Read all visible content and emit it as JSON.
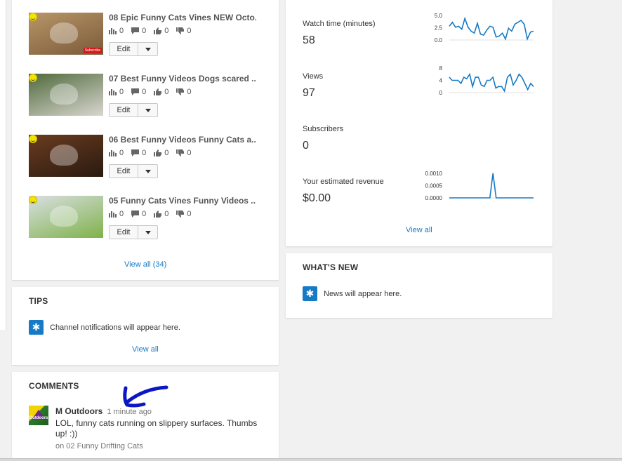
{
  "videos": {
    "items": [
      {
        "title": "08 Epic Funny Cats Vines NEW Octo...",
        "views": "0",
        "comments": "0",
        "likes": "0",
        "dislikes": "0",
        "edit_label": "Edit",
        "thumb_colors": [
          "#b89668",
          "#7a5a3a"
        ],
        "thumb_badge": "Subscribe"
      },
      {
        "title": "07 Best Funny Videos Dogs scared ...",
        "views": "0",
        "comments": "0",
        "likes": "0",
        "dislikes": "0",
        "edit_label": "Edit",
        "thumb_colors": [
          "#4f6a3c",
          "#d9d6cf"
        ]
      },
      {
        "title": "06 Best Funny Videos Funny Cats a...",
        "views": "0",
        "comments": "0",
        "likes": "0",
        "dislikes": "0",
        "edit_label": "Edit",
        "thumb_colors": [
          "#6a3c20",
          "#2a1a10"
        ]
      },
      {
        "title": "05 Funny Cats Vines Funny Videos ...",
        "views": "0",
        "comments": "0",
        "likes": "0",
        "dislikes": "0",
        "edit_label": "Edit",
        "thumb_colors": [
          "#d9dfe2",
          "#7fb24a"
        ]
      }
    ],
    "view_all": "View all (34)"
  },
  "tips": {
    "heading": "TIPS",
    "message": "Channel notifications will appear here.",
    "view_all": "View all"
  },
  "comments": {
    "heading": "COMMENTS",
    "items": [
      {
        "author": "M Outdoors",
        "time": "1 minute ago",
        "text": "LOL, funny cats running on slippery surfaces. Thumbs up! :))",
        "video": "on 02 Funny Drifting Cats",
        "avatar_text": "Outdoors"
      }
    ]
  },
  "analytics": {
    "metrics": [
      {
        "label": "Watch time (minutes)",
        "value": "58",
        "ticks": [
          "5.0",
          "2.5",
          "0.0"
        ],
        "max": 5,
        "series": [
          2.8,
          3.6,
          2.6,
          2.8,
          2.2,
          4.4,
          2.6,
          1.8,
          1.4,
          3.4,
          1.2,
          1.0,
          2.0,
          2.8,
          2.6,
          0.6,
          0.8,
          1.4,
          0.2,
          2.4,
          1.8,
          3.2,
          3.6,
          4.0,
          3.2,
          0.2,
          1.6,
          1.8
        ]
      },
      {
        "label": "Views",
        "value": "97",
        "ticks": [
          "8",
          "4",
          "0"
        ],
        "max": 8,
        "series": [
          5,
          4,
          4,
          4,
          3,
          5,
          4.5,
          6,
          2,
          5,
          5,
          2.5,
          2,
          4,
          4,
          5,
          1.5,
          2,
          2,
          0.5,
          5,
          6,
          2.5,
          4,
          6,
          5,
          3,
          1,
          3,
          2
        ]
      },
      {
        "label": "Subscribers",
        "value": "0"
      },
      {
        "label": "Your estimated revenue",
        "value": "$0.00",
        "ticks": [
          "0.0010",
          "0.0005",
          "0.0000"
        ],
        "max": 0.001,
        "series": [
          0,
          0,
          0,
          0,
          0,
          0,
          0,
          0,
          0,
          0,
          0,
          0,
          0,
          0,
          0.001,
          0,
          0,
          0,
          0,
          0,
          0,
          0,
          0,
          0,
          0,
          0,
          0,
          0
        ]
      }
    ],
    "view_all": "View all",
    "line_color": "#167ac6"
  },
  "whats_new": {
    "heading": "WHAT'S NEW",
    "message": "News will appear here."
  }
}
